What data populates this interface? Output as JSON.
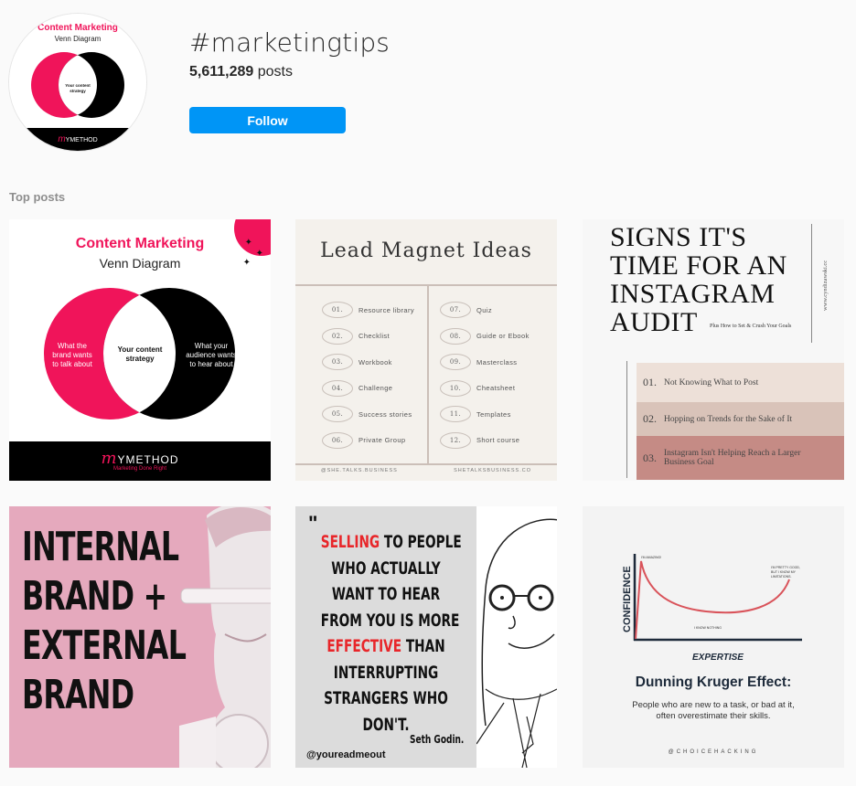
{
  "header": {
    "hashtag": "#marketingtips",
    "post_count": "5,611,289",
    "post_count_suffix": " posts",
    "follow_label": "Follow"
  },
  "avatar": {
    "title": "Content Marketing",
    "subtitle": "Venn Diagram",
    "left": "What the brand wants to talk about",
    "center": "Your content strategy",
    "right": "What your audience wants to hear about",
    "logo": "YMETHOD"
  },
  "section_label": "Top posts",
  "colors": {
    "accent_blue": "#0095f6",
    "venn_pink": "#f0145a",
    "brand_pink": "#e5a9bd",
    "quote_red": "#e8262a"
  },
  "posts": [
    {
      "id": "venn",
      "title": "Content Marketing",
      "subtitle": "Venn Diagram",
      "left_lines": [
        "What the",
        "brand wants",
        "to talk about"
      ],
      "center_lines": [
        "Your content",
        "strategy"
      ],
      "right_lines": [
        "What your",
        "audience wants",
        "to hear about"
      ],
      "logo_initial": "m",
      "logo_text": "YMETHOD",
      "tagline": "Marketing Done Right"
    },
    {
      "id": "lead-magnet",
      "title": "Lead Magnet Ideas",
      "items": [
        {
          "num": "01.",
          "label": "Resource library"
        },
        {
          "num": "02.",
          "label": "Checklist"
        },
        {
          "num": "03.",
          "label": "Workbook"
        },
        {
          "num": "04.",
          "label": "Challenge"
        },
        {
          "num": "05.",
          "label": "Success stories"
        },
        {
          "num": "06.",
          "label": "Private Group"
        },
        {
          "num": "07.",
          "label": "Quiz"
        },
        {
          "num": "08.",
          "label": "Guide or Ebook"
        },
        {
          "num": "09.",
          "label": "Masterclass"
        },
        {
          "num": "10.",
          "label": "Cheatsheet"
        },
        {
          "num": "11.",
          "label": "Templates"
        },
        {
          "num": "12.",
          "label": "Short course"
        }
      ],
      "footer_left": "@SHE.TALKS.BUSINESS",
      "footer_right": "SHETALKSBUSINESS.CO"
    },
    {
      "id": "instagram-audit",
      "title_lines": [
        "SIGNS IT'S",
        "TIME FOR AN",
        "INSTAGRAM",
        "AUDIT"
      ],
      "subtitle": "Plus How to Set & Crush Your Goals",
      "url": "www.cyndizawski.cc",
      "items": [
        {
          "num": "01.",
          "label": "Not Knowing What to Post",
          "color": "#ede0d8"
        },
        {
          "num": "02.",
          "label": "Hopping on Trends for the Sake of It",
          "color": "#d9c3b9"
        },
        {
          "num": "03.",
          "label": "Instagram Isn't Helping Reach a Larger Business Goal",
          "color": "#c58b85"
        }
      ]
    },
    {
      "id": "internal-external-brand",
      "lines": [
        "INTERNAL",
        "BRAND +",
        "EXTERNAL",
        "BRAND"
      ]
    },
    {
      "id": "seth-godin-quote",
      "open_quote": "\"",
      "lines": [
        [
          {
            "t": "SELLING",
            "red": true
          },
          {
            "t": " TO PEOPLE"
          }
        ],
        [
          {
            "t": "WHO ACTUALLY"
          }
        ],
        [
          {
            "t": "WANT TO HEAR"
          }
        ],
        [
          {
            "t": "FROM YOU IS MORE"
          }
        ],
        [
          {
            "t": "EFFECTIVE",
            "red": true
          },
          {
            "t": " THAN"
          }
        ],
        [
          {
            "t": "INTERRUPTING"
          }
        ],
        [
          {
            "t": "STRANGERS WHO"
          }
        ],
        [
          {
            "t": "DON'T."
          }
        ]
      ],
      "author": "Seth Godin.",
      "handle": "@youreadmeout"
    },
    {
      "id": "dunning-kruger",
      "y_label": "CONFIDENCE",
      "x_label": "EXPERTISE",
      "peak_label": "I'M AMAZING!",
      "valley_label": "I KNOW NOTHING",
      "end_label_lines": [
        "I'M PRETTY GOOD,",
        "BUT I KNOW MY",
        "LIMITATIONS."
      ],
      "title": "Dunning Kruger Effect:",
      "desc_lines": [
        "People who are new to a task, or bad at it,",
        "often overestimate their skills."
      ],
      "handle": "@CHOICEHACKING"
    }
  ]
}
